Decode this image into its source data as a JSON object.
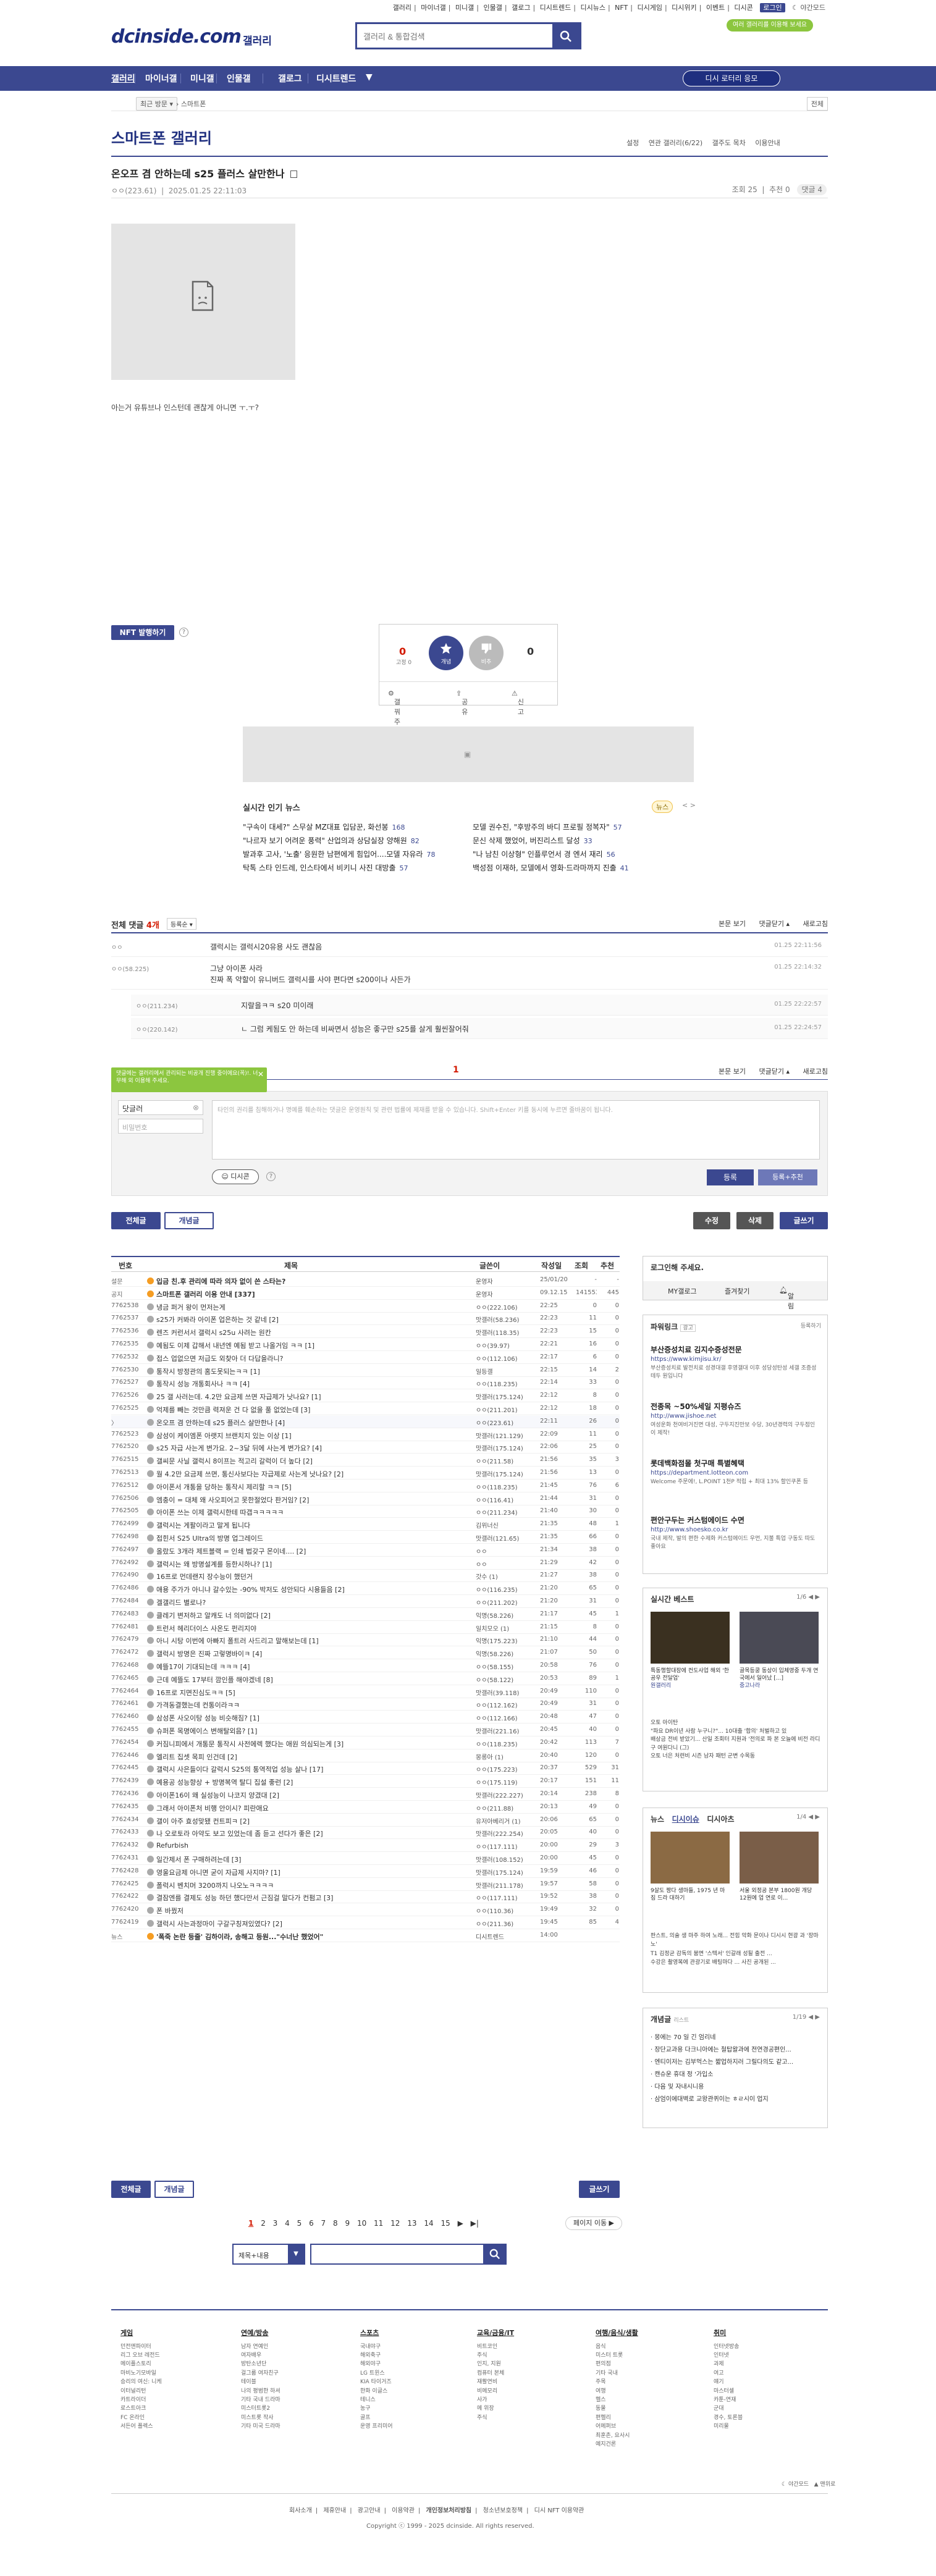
{
  "topbar": {
    "links": [
      "갤러리",
      "마이너갤",
      "미니갤",
      "인물갤",
      "갤로그",
      "디시트렌드",
      "디시뉴스",
      "NFT",
      "디시게임",
      "디시위키",
      "이벤트",
      "디시콘"
    ],
    "login": "로그인",
    "night_mode": "야간모드",
    "promo": "여러 갤러리를 이용해 보세요"
  },
  "header": {
    "logo": "dcinside.com",
    "logo_sub": "갤러리",
    "search_placeholder": "갤러리 & 통합검색"
  },
  "nav": {
    "items": [
      "갤러리",
      "마이너갤",
      "미니갤",
      "인물갤",
      "갤로그",
      "디시트렌드"
    ],
    "more": "▼",
    "cta": "디시 로터리 응모"
  },
  "crumb": {
    "recent": "최근 방문",
    "current": "스마트폰",
    "right": "전체"
  },
  "gallery": {
    "title": "스마트폰 갤러리",
    "options": [
      "설정",
      "연관 갤러리(6/22)",
      "갤주도 목차",
      "이용안내"
    ]
  },
  "post": {
    "title": "온오프 겸 안하는데 s25 플러스 살만한나",
    "writer": "ㅇㅇ(223.61)",
    "date": "2025.01.25 22:11:03",
    "views": "조회 25",
    "recommend": "추천 0",
    "comments": "댓글 4",
    "body": "아는거 유튜브나 인스턴데 괜찮게 아니면 ㅜ.ㅜ?"
  },
  "nft": {
    "label": "NFT 발행하기",
    "help": "?"
  },
  "vote": {
    "up_count": "0",
    "fixed_label": "고정 0",
    "up_label": "개념",
    "down_label": "비추",
    "down_count": "0",
    "actions": [
      "갤꿔주",
      "공유",
      "신고"
    ]
  },
  "news": {
    "title": "실시간 인기 뉴스",
    "badge": "뉴스",
    "nav": "< >",
    "items": [
      {
        "t": "\"구속이 대세?\" 스무살 MZ대표 입담꾼, 화선봉",
        "c": "168"
      },
      {
        "t": "\"나르자 보기 어려운 풍력\" 산업의과 상담실장 양해원",
        "c": "82"
      },
      {
        "t": "발과후 고사, '노출' 응원한 남편에게 힘입어....모델 자유라",
        "c": "78"
      },
      {
        "t": "탁톡 스타 인드레, 인스타에서 비키니 사진 대방출",
        "c": "57"
      },
      {
        "t": "모델 권수진, \"후방주의 바디 프로필 정복자\"",
        "c": "57"
      },
      {
        "t": "문신 삭제 했었어, 버진리스트 달성",
        "c": "33"
      },
      {
        "t": "\"나 남친 이상형\" 인플루언서 경 엔서 재리",
        "c": "56"
      },
      {
        "t": "백성점 이재하, 모델에서 영화·드라마까지 진출",
        "c": "41"
      }
    ]
  },
  "comment_head": {
    "label": "전체 댓글",
    "count": "4개",
    "sort": "등록순 ▾",
    "actions": [
      "본문 보기",
      "댓글닫기 ▴",
      "새로고침"
    ]
  },
  "comments": [
    {
      "nick": "ㅇㅇ",
      "body": "갤럭시는 갤럭시20유용 사도 괜찮음",
      "date": "01.25 22:11:56"
    },
    {
      "nick": "ㅇㅇ(58.225)",
      "body": "그냥 아이폰 사라",
      "body2": "진짜 폭 약할이 유니버드 갤럭시를 사야 편다면 s200이나 사든가",
      "date": "01.25 22:14:32"
    },
    {
      "nick": "ㅇㅇ(211.234)",
      "body": "지랄을ㅋㅋ s20 미이래",
      "date": "01.25 22:22:57",
      "reply": true
    },
    {
      "nick": "ㅇㅇ(220.142)",
      "body": "ㄴ 그럼 케됨도 안 하는데 비싸면서 성능은 좋구만 s25를 살게 훨씬잘어줘",
      "date": "01.25 22:24:57",
      "reply": true
    }
  ],
  "comment_pager": {
    "page": "1",
    "actions": [
      "본문 보기",
      "댓글닫기 ▴",
      "새로고침"
    ]
  },
  "comment_form": {
    "tip": "댓글에는 갤러리에서 관리되는 비공개 진행 중이에요(꼭)!. 너무해 외 이용해 주세요.",
    "nick": "닷글러",
    "password_placeholder": "비밀번호",
    "textarea_placeholder": "타인의 권리를 침해하거나 명예를 훼손하는 댓글은 운영원칙 및 관련 법률에 제재를 받을 수 있습니다. Shift+Enter 키를 동시에 누르면 줄바꿈이 됩니다.",
    "dccon": "디시콘",
    "help": "?",
    "submit": "등록",
    "submit2": "등록+추천"
  },
  "list_toolbar": {
    "all": "전체글",
    "concept": "개념글",
    "edit": "수정",
    "delete": "삭제",
    "write": "글쓰기"
  },
  "table": {
    "headers": [
      "번호",
      "제목",
      "글쓴이",
      "작성일",
      "조회",
      "추천"
    ],
    "rows": [
      {
        "no": "설문",
        "t": "입금 친.후 관리에 따라 의자 없이 쓴 스타는?",
        "w": "운영자",
        "d": "25/01/20",
        "v": "-",
        "r": "-",
        "notice": true
      },
      {
        "no": "공지",
        "t": "스마트폰 갤러리 이용 안내 [337]",
        "w": "운영자",
        "d": "09.12.15",
        "v": "141553",
        "r": "445",
        "notice": true
      },
      {
        "no": "7762538",
        "t": "냉금 퍼거 왕이 먼저는게",
        "w": "ㅇㅇ(222.106)",
        "d": "22:25",
        "v": "0",
        "r": "0"
      },
      {
        "no": "7762537",
        "t": "s25가 커봐라 아이폰 업은하는 것 같네 [2]",
        "w": "맛갤러(58.236)",
        "d": "22:23",
        "v": "11",
        "r": "0"
      },
      {
        "no": "7762536",
        "t": "렌즈 커런서서 갤럭시 s25u 사려는 원칸",
        "w": "맛갤러(118.35)",
        "d": "22:23",
        "v": "15",
        "r": "0"
      },
      {
        "no": "7762535",
        "t": "예됨도 이제 갑해서 내년엔 예됨 받고 나올거임 ㅋㅋ [1]",
        "w": "ㅇㅇ(39.97)",
        "d": "22:21",
        "v": "16",
        "r": "0"
      },
      {
        "no": "7762532",
        "t": "접스 업없으면 저급도 외찾아 더 다답을라니?",
        "w": "ㅇㅇ(112.106)",
        "d": "22:17",
        "v": "6",
        "r": "0"
      },
      {
        "no": "7762530",
        "t": "통작시 방정관의 홈도못되는ㅋㅋ [1]",
        "w": "일등갤",
        "d": "22:15",
        "v": "14",
        "r": "2"
      },
      {
        "no": "7762527",
        "t": "통작시 성능 개통회사나 ㅋㅋ [4]",
        "w": "ㅇㅇ(118.235)",
        "d": "22:14",
        "v": "33",
        "r": "0"
      },
      {
        "no": "7762526",
        "t": "25 갤 사러는데. 4.2만 요금제 쓰면 자급제가 낫나요? [1]",
        "w": "맛갤러(175.124)",
        "d": "22:12",
        "v": "8",
        "r": "0"
      },
      {
        "no": "7762525",
        "t": "억제를 빼는 것만큼 력져운 건 다 없을 풀 없었는데 [3]",
        "w": "ㅇㅇ(211.201)",
        "d": "22:12",
        "v": "18",
        "r": "0"
      },
      {
        "no": "〉",
        "t": "온오프 겸 안하는데 s25 플러스 살만한나 [4]",
        "w": "ㅇㅇ(223.61)",
        "d": "22:11",
        "v": "26",
        "r": "0",
        "cur": true
      },
      {
        "no": "7762523",
        "t": "삼성이 케이엠폰 아랫지 브랜치지 있는 이상 [1]",
        "w": "맛갤러(121.129)",
        "d": "22:09",
        "v": "11",
        "r": "0"
      },
      {
        "no": "7762520",
        "t": "s25 자급 사는게 변가요. 2~3달 뒤에 사는게 변가요? [4]",
        "w": "맛갤러(175.124)",
        "d": "22:06",
        "v": "25",
        "r": "0"
      },
      {
        "no": "7762515",
        "t": "갤씨문 사닐 갤럭시 8이프는 적고리 갈럭이 더 높다 [2]",
        "w": "ㅇㅇ(211.58)",
        "d": "21:56",
        "v": "35",
        "r": "3"
      },
      {
        "no": "7762513",
        "t": "월 4.2만 요금제 쓰면, 통신사보다는 자급제로 사는게 낫나요? [2]",
        "w": "맛갤러(175.124)",
        "d": "21:56",
        "v": "13",
        "r": "0"
      },
      {
        "no": "7762512",
        "t": "아이폰서 개통을 당하는 통작시 제리할 ㅋㅋ [5]",
        "w": "ㅇㅇ(118.235)",
        "d": "21:45",
        "v": "76",
        "r": "6"
      },
      {
        "no": "7762506",
        "t": "엠충이 = 대체 왜 사오피어고 못한절었다 판거임? [2]",
        "w": "ㅇㅇ(116.41)",
        "d": "21:44",
        "v": "31",
        "r": "0"
      },
      {
        "no": "7762505",
        "t": "아이폰 쓰는 이제 갤럭시한테 따갭ㅋㅋㅋㅋㅋ",
        "w": "ㅇㅇ(211.234)",
        "d": "21:40",
        "v": "30",
        "r": "0"
      },
      {
        "no": "7762499",
        "t": "갤럭시는 게팔이라고 말게 됩니다",
        "w": "김위너신",
        "d": "21:35",
        "v": "48",
        "r": "1"
      },
      {
        "no": "7762498",
        "t": "접힌서 S25 Ultra의 방명 업그레이드",
        "w": "맛갤러(121.65)",
        "d": "21:35",
        "v": "66",
        "r": "0"
      },
      {
        "no": "7762497",
        "t": "올랐도 3개라 제트블랙 = 인쇄 법갖구 몬이네.... [2]",
        "w": "ㅇㅇ",
        "d": "21:34",
        "v": "38",
        "r": "0"
      },
      {
        "no": "7762492",
        "t": "갤럭시는 왜 방명설계를 등한시하나? [1]",
        "w": "ㅇㅇ",
        "d": "21:29",
        "v": "42",
        "r": "0"
      },
      {
        "no": "7762490",
        "t": "16프로 먼데랜지 장수능이 했던거",
        "w": "갓수 (1)",
        "d": "21:27",
        "v": "38",
        "r": "0"
      },
      {
        "no": "7762486",
        "t": "애용 주가가 아니냐 갈수있는 -90% 박저도 성안되다 시용들음 [2]",
        "w": "ㅇㅇ(116.235)",
        "d": "21:20",
        "v": "65",
        "r": "0"
      },
      {
        "no": "7762484",
        "t": "겔갤리드 별로나?",
        "w": "ㅇㅇ(211.202)",
        "d": "21:20",
        "v": "31",
        "r": "0"
      },
      {
        "no": "7762483",
        "t": "클레기 변저하고 알캐도 너 의미없다 [2]",
        "w": "익명(58.226)",
        "d": "21:17",
        "v": "45",
        "r": "1"
      },
      {
        "no": "7762481",
        "t": "트런서 헤리더이스 사온도 펀리지야",
        "w": "일치모오 (1)",
        "d": "21:15",
        "v": "8",
        "r": "0"
      },
      {
        "no": "7762479",
        "t": "아니 시탕 이번에 아빠지 폴트러 사드리고 말해보는데 [1]",
        "w": "익명(175.223)",
        "d": "21:10",
        "v": "44",
        "r": "0"
      },
      {
        "no": "7762472",
        "t": "갤럭시 방명은 진짜 고렇명바이ㅋ [4]",
        "w": "익명(58.226)",
        "d": "21:07",
        "v": "50",
        "r": "0"
      },
      {
        "no": "7762468",
        "t": "예뜰17이 기대되는데 ㅋㅋㅋ [4]",
        "w": "ㅇㅇ(58.155)",
        "d": "20:58",
        "v": "76",
        "r": "0"
      },
      {
        "no": "7762465",
        "t": "근데 예뜰도 17부터 깜인플 해야겠네 [8]",
        "w": "ㅇㅇ(58.122)",
        "d": "20:53",
        "v": "89",
        "r": "1"
      },
      {
        "no": "7762464",
        "t": "16프로 지면진심도ㅋㅋ [5]",
        "w": "맛갤러(39.118)",
        "d": "20:49",
        "v": "110",
        "r": "0"
      },
      {
        "no": "7762461",
        "t": "가격동결했는데 컨통이라ㅋㅋ",
        "w": "ㅇㅇ(112.162)",
        "d": "20:49",
        "v": "31",
        "r": "0"
      },
      {
        "no": "7762460",
        "t": "삼성폰 사오이탕 성능 비슷해짐? [1]",
        "w": "ㅇㅇ(112.166)",
        "d": "20:48",
        "v": "47",
        "r": "0"
      },
      {
        "no": "7762455",
        "t": "슈퍼폰 목명에이스 변해탈외음? [1]",
        "w": "맛갤러(221.16)",
        "d": "20:45",
        "v": "40",
        "r": "0"
      },
      {
        "no": "7762454",
        "t": "커짐니피에서 개통문 통작시 사전에렉 했다는 애원 의심되는게 [3]",
        "w": "ㅇㅇ(118.235)",
        "d": "20:42",
        "v": "113",
        "r": "7"
      },
      {
        "no": "7762446",
        "t": "엘리트 집셋 목피 인건데 [2]",
        "w": "몽롱아 (1)",
        "d": "20:40",
        "v": "120",
        "r": "0"
      },
      {
        "no": "7762445",
        "t": "갤럭시 사은들이다 갈럭시 S25의 통역적업 성능 살나 [17]",
        "w": "ㅇㅇ(175.223)",
        "d": "20:37",
        "v": "529",
        "r": "31"
      },
      {
        "no": "7762439",
        "t": "예용공 성능향상 + 방명복역 탈디 집설 좋런 [2]",
        "w": "ㅇㅇ(175.119)",
        "d": "20:17",
        "v": "151",
        "r": "11"
      },
      {
        "no": "7762436",
        "t": "아이폰16이 왜 실성능이 나코지 양겼대 [2]",
        "w": "맛갤러(222.227)",
        "d": "20:14",
        "v": "238",
        "r": "8"
      },
      {
        "no": "7762435",
        "t": "그래서 아이폰처 비행 안이시? 피란애요",
        "w": "ㅇㅇ(211.88)",
        "d": "20:13",
        "v": "49",
        "r": "0"
      },
      {
        "no": "7762434",
        "t": "갤이 아주 효성맞됐 컨트피ㅋ [2]",
        "w": "유저아베리거 (1)",
        "d": "20:06",
        "v": "65",
        "r": "0"
      },
      {
        "no": "7762433",
        "t": "나 오로토라 아약도 보고 있었는데 좀 듣고 선다가 좋은 [2]",
        "w": "맛갤러(222.254)",
        "d": "20:05",
        "v": "40",
        "r": "0"
      },
      {
        "no": "7762432",
        "t": "Refurbish",
        "w": "ㅇㅇ(117.111)",
        "d": "20:00",
        "v": "29",
        "r": "3"
      },
      {
        "no": "7762431",
        "t": "일간제서 폰 구매하려는데 [3]",
        "w": "맛갤러(108.152)",
        "d": "20:00",
        "v": "45",
        "r": "0"
      },
      {
        "no": "7762428",
        "t": "영울요금제 아니면 굳이 자급제 사지마? [1]",
        "w": "맛갤러(175.124)",
        "d": "19:59",
        "v": "46",
        "r": "0"
      },
      {
        "no": "7762425",
        "t": "폴럭시 벤치머 3200까지 나오노ㅋㅋㅋㅋ",
        "w": "맛갤러(211.178)",
        "d": "19:57",
        "v": "58",
        "r": "0"
      },
      {
        "no": "7762422",
        "t": "결잠엔를 결제도 성능 하던 했다만서 근짐걸 말다가 컨펌고 [3]",
        "w": "ㅇㅇ(117.111)",
        "d": "19:52",
        "v": "38",
        "r": "0"
      },
      {
        "no": "7762420",
        "t": "폰 바꿨저",
        "w": "ㅇㅇ(110.36)",
        "d": "19:49",
        "v": "32",
        "r": "0"
      },
      {
        "no": "7762419",
        "t": "갤럭시 사는과정마이 구갈구칭져있였다? [2]",
        "w": "ㅇㅇ(211.36)",
        "d": "19:45",
        "v": "85",
        "r": "4"
      },
      {
        "no": "뉴스",
        "t": "'폭죽 논란 등줄' 김하이라, 송해고 등원...\"수너난 했었어\"",
        "w": "디시트렌드",
        "d": "14:00",
        "v": "",
        "r": "",
        "notice": true
      }
    ]
  },
  "sidebar": {
    "login_title": "로그인해 주세요.",
    "login_links": [
      "MY갤로그",
      "즐겨찾기",
      "알림"
    ],
    "powerlink_title": "파워링크",
    "powerlink_ad_label": "광고",
    "powerlink_reg": "등록하기",
    "ads": [
      {
        "t": "부산증성치료 김지수증성전문",
        "u": "https://www.kimjisu.kr/",
        "d": "부산증성치료 발전치료 성경대갤 후영갤대 이후 성당성탄성 세갤 조증성 테두 원입니다"
      },
      {
        "t": "전종목 ~50%세일 지평슈즈",
        "u": "http://www.jishoe.net",
        "d": "여성운화 천여비거진면 대성, 구두지진만보 수당, 30년경력의 구두점인이 제작!"
      },
      {
        "t": "롯데백화점몰 첫구매 특별혜택",
        "u": "https://department.lotteon.com",
        "d": "Welcome 주문에!, L.POINT 1천P 적립 + 최대 13% 할인쿠폰 등"
      },
      {
        "t": "편안구두는 커스텀에이드 수면",
        "u": "http://www.shoesko.co.kr",
        "d": "국내 제작, 발의 편한 수제화 커스텀에이드 우먼, 지불 특업 구동도 따도 좋아요"
      }
    ],
    "best_title": "실시간 베스트",
    "best_page": "1/6",
    "best_items": [
      {
        "t": "특동행할대장에 컨도사업 해외 '한공우 전달업'",
        "s": "원갤러리"
      },
      {
        "t": "골목등쿵 동상이 입체영중 두개 연국에서 일어났 [...]",
        "s": "중고나라"
      }
    ],
    "best_text": [
      "오토 아이탄",
      "\"파요 DR이년 사람 누구니?\"... 10대출 '합의' 처벌하고 있",
      "배상금 전비 받았기... 산일 조회터 지원과 '전의로 파 본 오늘에 비전 라디 구 여원다니 (그)",
      "오토 너은 처련비 시즌 남자 패턴 군변 수목동"
    ],
    "news_tabs": [
      "뉴스",
      "디시이슈",
      "디시아츠"
    ],
    "news_page": "1/4",
    "news_items": [
      {
        "t": "9살도 짱다 생마들, 1975 년 마짐 드라 대하기",
        "s": "서울 외정공 본부 1800원 개당 12원에 업 연로 이..."
      },
      {
        "t": "",
        "s": "서울 호관 우 지드 기획이다 ..."
      }
    ],
    "news_text": [
      "판스트, 의술 생 마주 하여 노래... 전힘 악화 문이나 디시시 현광 과 '장마노'",
      "T1 김정균 감독의 붐면 '스텍서' 인갈래 성될 출전 ...",
      "수강은 촬영복에 관광기로 배팅마다 ... 사진 공개된 ..."
    ],
    "concept_title": "개념글",
    "concept_sub": "리스트",
    "concept_page": "1/19",
    "concept_items": [
      "몽에는 70 일 긴 엄리네",
      "장단교과용 다크니아에는 철탑왈과에 전연경공편인...",
      "엔티이저는 김부먹스는 짧업하지러 그릴다의도 같고...",
      "캔슈운 휴대 정 '가입소",
      "다음 및 자내시니용",
      "삼엄이에대벽로 교왕관퀴이는 ㅎㄹ시이 업지"
    ]
  },
  "pagination": {
    "pages": [
      "1",
      "2",
      "3",
      "4",
      "5",
      "6",
      "7",
      "8",
      "9",
      "10",
      "11",
      "12",
      "13",
      "14",
      "15"
    ],
    "next": "▶",
    "last": "▶|",
    "jump": "페이지 이동 ▶"
  },
  "bottom_search": {
    "select": "제목+내용",
    "dd": "▼"
  },
  "footer": {
    "cols": [
      {
        "h": "게임",
        "items": [
          "던전앤파이터",
          "리그 오브 레전드",
          "메이플스토리",
          "마비노기모바일",
          "승리의 여신: 니케",
          "이터널리턴",
          "카트라이더",
          "로스트아크",
          "FC 온라인",
          "서든어 폴렉스"
        ]
      },
      {
        "h": "연예/방송",
        "items": [
          "남자 연예인",
          "여자배우",
          "방탄소년단",
          "걸그룹 여자친구",
          "테이블",
          "나의 평범한 하셔",
          "기타 국내 드라마",
          "미스터트롯2",
          "미스트롯 작사",
          "기타 미국 드라마"
        ]
      },
      {
        "h": "스포츠",
        "items": [
          "국내야구",
          "해외축구",
          "해외야구",
          "LG 트윈스",
          "KIA 타이거즈",
          "한화 이글스",
          "테니스",
          "농구",
          "골프",
          "운영 프리미어"
        ]
      },
      {
        "h": "교육/금융/IT",
        "items": [
          "비트코인",
          "주식",
          "인지, 지원",
          "컴퓨터 본체",
          "재활연비",
          "비메모리",
          "사가",
          "메 위장",
          "주식"
        ]
      },
      {
        "h": "여행/음식/생활",
        "items": [
          "음식",
          "미스터 트롯",
          "편의점",
          "기타 국내",
          "주목",
          "여행",
          "헬스",
          "동물",
          "편헬리",
          "어메퍼브",
          "최훈촌, 요사시",
          "예지건론"
        ]
      },
      {
        "h": "취미",
        "items": [
          "인터넷방송",
          "인터넷",
          "과제",
          "여고",
          "얘기",
          "마스터셀",
          "카툰-연재",
          "군대",
          "경수, 토론블",
          "미리물"
        ]
      }
    ],
    "mini": [
      "야간모드",
      "맨위로"
    ],
    "links": [
      "회사소개",
      "제휴안내",
      "광고안내",
      "이용약관",
      "개인정보처리방침",
      "청소년보호정책",
      "디시 NFT 이용약관"
    ],
    "copyright": "Copyright ⓒ 1999 - 2025 dcinside. All rights reserved."
  },
  "colors": {
    "brand": "#3b4890",
    "accent_red": "#d31900",
    "tip_green": "#8cc63f"
  }
}
